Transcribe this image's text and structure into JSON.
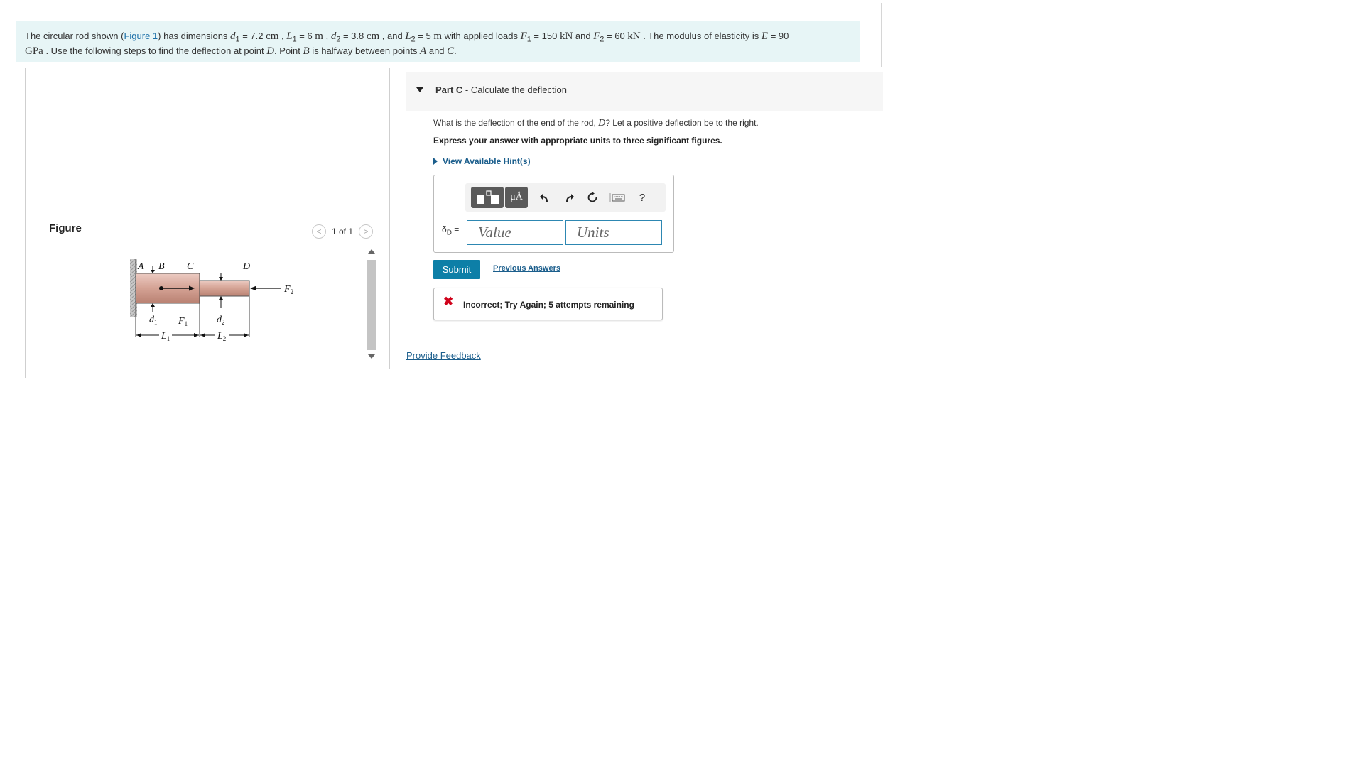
{
  "problem": {
    "p1": "The circular rod shown (",
    "figure_link": "Figure 1",
    "p2": ") has dimensions ",
    "d1_sym": "d",
    "d1_sub": "1",
    "d1_eq": " = 7.2 ",
    "d1_unit": "cm",
    "sep1": " , ",
    "L1_sym": "L",
    "L1_sub": "1",
    "L1_eq": " = 6 ",
    "L1_unit": "m",
    "sep2": " , ",
    "d2_sym": "d",
    "d2_sub": "2",
    "d2_eq": " = 3.8 ",
    "d2_unit": "cm",
    "sep3": " , and ",
    "L2_sym": "L",
    "L2_sub": "2",
    "L2_eq": " = 5 ",
    "L2_unit": "m",
    "p3": " with applied loads ",
    "F1_sym": "F",
    "F1_sub": "1",
    "F1_eq": " = 150 ",
    "F1_unit": "kN",
    "p4": " and ",
    "F2_sym": "F",
    "F2_sub": "2",
    "F2_eq": " = 60 ",
    "F2_unit": "kN",
    "p5": " . The modulus of elasticity is ",
    "E_sym": "E",
    "E_eq": " = 90",
    "E_unit": "GPa",
    "p6": " . Use the following steps to find the deflection at point ",
    "pt_D": "D",
    "p7": ". Point ",
    "pt_B": "B",
    "p8": " is halfway between points ",
    "pt_A": "A",
    "p9": " and ",
    "pt_C": "C",
    "p10": "."
  },
  "figure": {
    "label": "Figure",
    "pager": "1 of 1",
    "prev_glyph": "<",
    "next_glyph": ">",
    "labels": {
      "A": "A",
      "B": "B",
      "C": "C",
      "D": "D",
      "F1": "F",
      "F1_sub": "1",
      "F2": "F",
      "F2_sub": "2",
      "d1": "d",
      "d1_sub": "1",
      "d2": "d",
      "d2_sub": "2",
      "L1": "L",
      "L1_sub": "1",
      "L2": "L",
      "L2_sub": "2"
    }
  },
  "part": {
    "label": "Part C",
    "dash": " - ",
    "title": "Calculate the deflection",
    "question_1": "What is the deflection of the end of the rod, ",
    "question_D": "D",
    "question_2": "? Let a positive deflection be to the right.",
    "instruction": "Express your answer with appropriate units to three significant figures.",
    "hint": "View Available Hint(s)"
  },
  "answer": {
    "units_button": "μÅ",
    "help_button": "?",
    "delta_symbol": "δ",
    "delta_sub": "D",
    "delta_eq": " =",
    "value_placeholder": "Value",
    "units_placeholder": "Units"
  },
  "actions": {
    "submit": "Submit",
    "previous_answers": "Previous Answers"
  },
  "feedback": {
    "icon": "✖",
    "message": "Incorrect; Try Again; 5 attempts remaining"
  },
  "footer": {
    "provide_feedback": "Provide Feedback"
  },
  "colors": {
    "problem_bg": "#e7f5f6",
    "link": "#1b5e8c",
    "submit_bg": "#0d7fa7",
    "error": "#d0021b",
    "rod": "#d8a99c"
  }
}
